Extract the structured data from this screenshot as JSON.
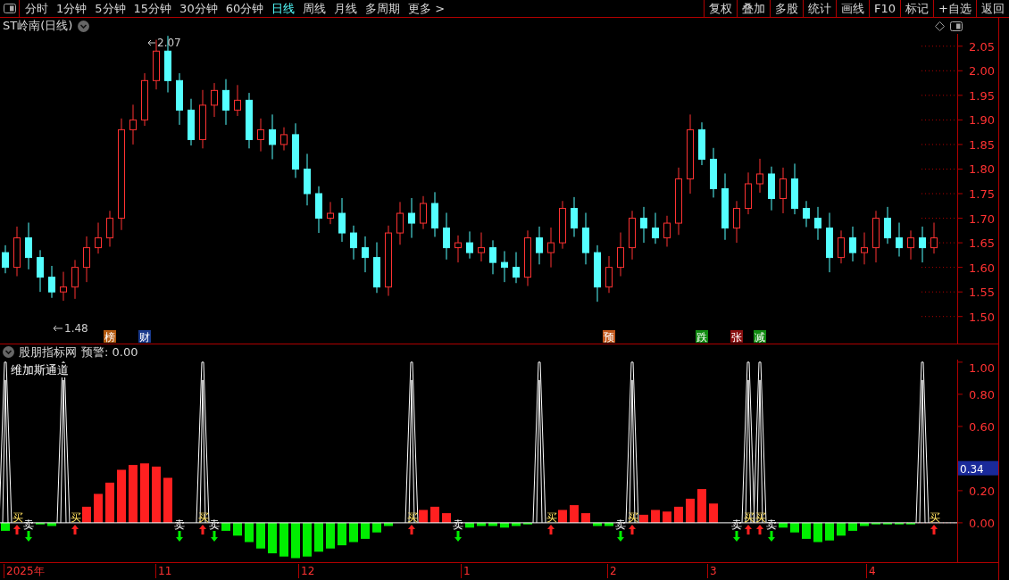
{
  "toolbar": {
    "tabs": [
      {
        "label": "分时",
        "selected": false
      },
      {
        "label": "1分钟",
        "selected": false
      },
      {
        "label": "5分钟",
        "selected": false
      },
      {
        "label": "15分钟",
        "selected": false
      },
      {
        "label": "30分钟",
        "selected": false
      },
      {
        "label": "60分钟",
        "selected": false
      },
      {
        "label": "日线",
        "selected": true
      },
      {
        "label": "周线",
        "selected": false
      },
      {
        "label": "月线",
        "selected": false
      },
      {
        "label": "多周期",
        "selected": false
      },
      {
        "label": "更多 >",
        "selected": false
      }
    ],
    "buttons": [
      "复权",
      "叠加",
      "多股",
      "统计",
      "画线",
      "F10",
      "标记",
      "+自选",
      "返回"
    ]
  },
  "main_chart": {
    "title": "ST岭南(日线)",
    "price_axis": [
      "2.05",
      "2.00",
      "1.95",
      "1.90",
      "1.85",
      "1.80",
      "1.75",
      "1.70",
      "1.65",
      "1.60",
      "1.55",
      "1.50"
    ],
    "high_label": "2.07",
    "low_label": "1.48",
    "event_tags": [
      {
        "text": "榜",
        "color": "#b35a10"
      },
      {
        "text": "财",
        "color": "#1a3a8c"
      },
      {
        "text": "预",
        "color": "#c0561a"
      },
      {
        "text": "跌",
        "color": "#118a11"
      },
      {
        "text": "张",
        "color": "#8a1010"
      },
      {
        "text": "减",
        "color": "#118a11"
      }
    ]
  },
  "indicator": {
    "name": "股朋指标网",
    "alert": "预警: 0.00",
    "formula": "维加斯通道",
    "axis": [
      "1.00",
      "0.80",
      "0.60",
      "0.20",
      "0.00"
    ],
    "current_value": "0.34",
    "signals": [
      {
        "kind": "buy",
        "text": "买"
      },
      {
        "kind": "sell",
        "text": "卖"
      },
      {
        "kind": "buy",
        "text": "买"
      },
      {
        "kind": "sell",
        "text": "卖"
      },
      {
        "kind": "buy",
        "text": "买"
      },
      {
        "kind": "sell",
        "text": "卖"
      },
      {
        "kind": "buy",
        "text": "买"
      },
      {
        "kind": "sell",
        "text": "卖"
      },
      {
        "kind": "buy",
        "text": "买"
      },
      {
        "kind": "sell",
        "text": "卖"
      },
      {
        "kind": "buy",
        "text": "买"
      },
      {
        "kind": "sell",
        "text": "卖"
      },
      {
        "kind": "buy",
        "text": "买"
      },
      {
        "kind": "buy",
        "text": "买"
      },
      {
        "kind": "sell",
        "text": "卖"
      },
      {
        "kind": "buy",
        "text": "买"
      }
    ]
  },
  "date_axis": [
    "2025年",
    "11",
    "12",
    "1",
    "2",
    "3",
    "4"
  ]
}
